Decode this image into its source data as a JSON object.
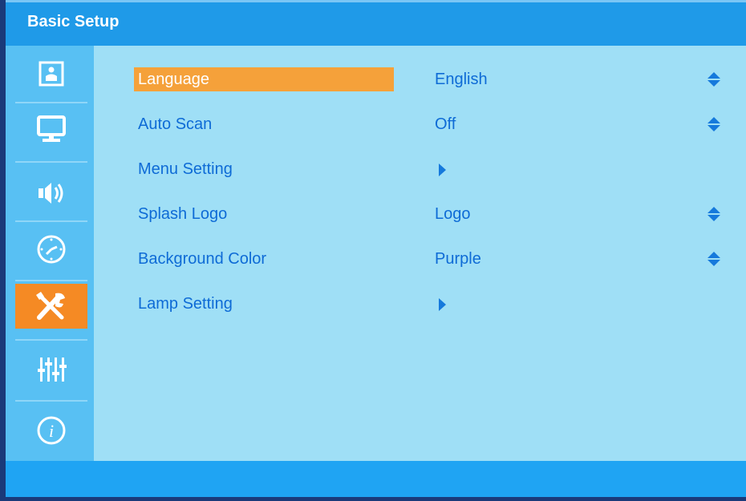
{
  "header": {
    "title": "Basic Setup"
  },
  "sidebar": {
    "items": [
      {
        "icon": "picture-icon"
      },
      {
        "icon": "display-icon"
      },
      {
        "icon": "audio-icon"
      },
      {
        "icon": "timer-icon"
      },
      {
        "icon": "setup-tools-icon",
        "active": true
      },
      {
        "icon": "advanced-sliders-icon"
      },
      {
        "icon": "info-icon"
      }
    ]
  },
  "menu": {
    "rows": [
      {
        "label": "Language",
        "value": "English",
        "control": "updown",
        "selected": true
      },
      {
        "label": "Auto Scan",
        "value": "Off",
        "control": "updown"
      },
      {
        "label": "Menu Setting",
        "value": "",
        "control": "submenu"
      },
      {
        "label": "Splash Logo",
        "value": "Logo",
        "control": "updown"
      },
      {
        "label": "Background Color",
        "value": "Purple",
        "control": "updown"
      },
      {
        "label": "Lamp Setting",
        "value": "",
        "control": "submenu"
      }
    ]
  },
  "colors": {
    "header": "#1f9ae8",
    "sidebar": "#58c0f3",
    "content": "#9fdff6",
    "accent": "#f58a24",
    "text": "#0e6bd6"
  }
}
